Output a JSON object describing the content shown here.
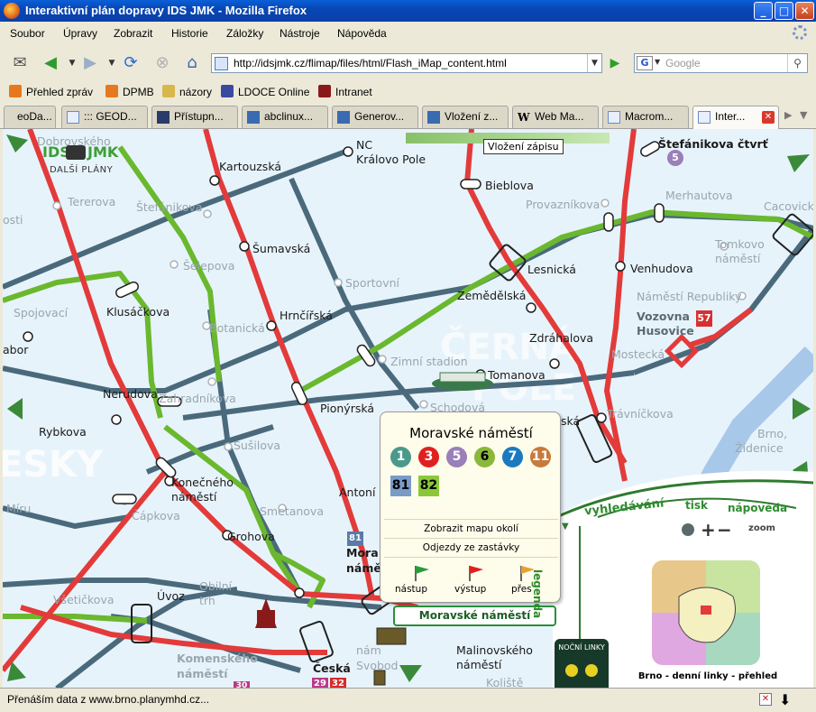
{
  "window": {
    "title": "Interaktivní plán dopravy IDS JMK - Mozilla Firefox",
    "minimize": "_",
    "maximize": "□",
    "close": "✕"
  },
  "menu": {
    "items": [
      "Soubor",
      "Úpravy",
      "Zobrazit",
      "Historie",
      "Záložky",
      "Nástroje",
      "Nápověda"
    ]
  },
  "navigation": {
    "url": "http://idsjmk.cz/flimap/files/html/Flash_iMap_content.html",
    "search_placeholder": "Google",
    "search_engine_letter": "G"
  },
  "bookmarks": [
    {
      "label": "Přehled zpráv",
      "icon": "rss-icon",
      "color": "#e8781e"
    },
    {
      "label": "DPMB",
      "icon": "rss-icon",
      "color": "#e8781e"
    },
    {
      "label": "názory",
      "icon": "folder-icon",
      "color": "#d8b84a"
    },
    {
      "label": "LDOCE Online",
      "icon": "ldoce-icon",
      "color": "#3a4aa0"
    },
    {
      "label": "Intranet",
      "icon": "intranet-icon",
      "color": "#8a1a1a"
    }
  ],
  "tabs": [
    {
      "label": "eoDa...",
      "active": false
    },
    {
      "label": "::: GEOD...",
      "active": false
    },
    {
      "label": "Přístupn...",
      "active": false
    },
    {
      "label": "abclinux...",
      "active": false
    },
    {
      "label": "Generov...",
      "active": false
    },
    {
      "label": "Vložení z...",
      "active": false
    },
    {
      "label": "Web Ma...",
      "active": false
    },
    {
      "label": "Macrom...",
      "active": false
    },
    {
      "label": "Inter...",
      "active": true
    }
  ],
  "map": {
    "tooltip": "Vložení zápisu",
    "logo": {
      "left": "IDS",
      "right": "JMK",
      "sub": "DALŠÍ PLÁNY"
    },
    "stations": [
      {
        "name": "Dobrovského",
        "faint": true
      },
      {
        "name": "Kartouzská",
        "faint": false
      },
      {
        "name": "NC",
        "faint": false
      },
      {
        "name": "Královo Pole",
        "faint": false
      },
      {
        "name": "Štefánikova čtvrť",
        "faint": false,
        "bold": true
      },
      {
        "name": "Bieblova",
        "faint": false
      },
      {
        "name": "Provazníkova",
        "faint": true
      },
      {
        "name": "Merhautova",
        "faint": true
      },
      {
        "name": "Cacovick",
        "faint": true
      },
      {
        "name": "Tererova",
        "faint": true
      },
      {
        "name": "Štefánikova",
        "faint": true
      },
      {
        "name": "osti",
        "faint": true
      },
      {
        "name": "Šumavská",
        "faint": false
      },
      {
        "name": "Šelepova",
        "faint": true
      },
      {
        "name": "Sportovní",
        "faint": true
      },
      {
        "name": "Lesnická",
        "faint": false
      },
      {
        "name": "Venhudova",
        "faint": false
      },
      {
        "name": "Tomkovo",
        "faint": true
      },
      {
        "name": "náměstí",
        "faint": true
      },
      {
        "name": "Spojovací",
        "faint": true
      },
      {
        "name": "Klusáčkova",
        "faint": false
      },
      {
        "name": "Hrnčířská",
        "faint": false
      },
      {
        "name": "Zemědělská",
        "faint": false
      },
      {
        "name": "Náměstí Republiky",
        "faint": true
      },
      {
        "name": "Botanická",
        "faint": true
      },
      {
        "name": "Zdráhalova",
        "faint": false
      },
      {
        "name": "Vozovna",
        "faint": false,
        "bold": true
      },
      {
        "name": "Husovice",
        "faint": false,
        "bold": true
      },
      {
        "name": "Mostecká",
        "faint": true
      },
      {
        "name": "abor",
        "faint": false
      },
      {
        "name": "Zimní stadion",
        "faint": true
      },
      {
        "name": "Tomanova",
        "faint": false
      },
      {
        "name": "Nerudova",
        "faint": false
      },
      {
        "name": "Zahradníkova",
        "faint": true
      },
      {
        "name": "Pionýrská",
        "faint": false
      },
      {
        "name": "Schodová",
        "faint": true
      },
      {
        "name": "ská",
        "faint": false
      },
      {
        "name": "Trávníčkova",
        "faint": true
      },
      {
        "name": "Rybkova",
        "faint": false
      },
      {
        "name": "Sušilova",
        "faint": true
      },
      {
        "name": "Brno,",
        "faint": true
      },
      {
        "name": "Židenice",
        "faint": true
      },
      {
        "name": "Konečného",
        "faint": false
      },
      {
        "name": "náměstí",
        "faint": false
      },
      {
        "name": "Antoní",
        "faint": false
      },
      {
        "name": "Míru",
        "faint": true
      },
      {
        "name": "Čápkova",
        "faint": true
      },
      {
        "name": "Smetanova",
        "faint": true
      },
      {
        "name": "Grohova",
        "faint": false
      },
      {
        "name": "Mora",
        "faint": false,
        "bold": true
      },
      {
        "name": "námě",
        "faint": false,
        "bold": true
      },
      {
        "name": "Všetičkova",
        "faint": true
      },
      {
        "name": "Úvoz",
        "faint": false
      },
      {
        "name": "Obilní",
        "faint": true
      },
      {
        "name": "trh",
        "faint": true
      },
      {
        "name": "Komenského",
        "faint": true,
        "bold": true
      },
      {
        "name": "náměstí",
        "faint": true,
        "bold": true
      },
      {
        "name": "Česká",
        "faint": false,
        "bold": true
      },
      {
        "name": "nám",
        "faint": true
      },
      {
        "name": "Svobod",
        "faint": true
      },
      {
        "name": "Malinovského",
        "faint": false
      },
      {
        "name": "náměstí",
        "faint": false
      },
      {
        "name": "Koliště",
        "faint": true
      }
    ],
    "districts": [
      "ČERNÁ",
      "POLE",
      "ESKY"
    ],
    "badges": [
      {
        "text": "5",
        "color": "#9a7fb8"
      },
      {
        "text": "57",
        "color": "#d83030"
      },
      {
        "text": "81",
        "color": "#5a7aa8"
      },
      {
        "text": "29",
        "color": "#b83a8a"
      },
      {
        "text": "32",
        "color": "#d82a2a"
      },
      {
        "text": "30",
        "color": "#b83a8a"
      }
    ]
  },
  "popup": {
    "title": "Moravské náměstí",
    "lines": [
      {
        "num": "1",
        "color": "#4a9a8a"
      },
      {
        "num": "3",
        "color": "#e02020"
      },
      {
        "num": "5",
        "color": "#9a7fb8"
      },
      {
        "num": "6",
        "color": "#8ab83a"
      },
      {
        "num": "7",
        "color": "#1a7ac0"
      },
      {
        "num": "11",
        "color": "#c87a3a"
      }
    ],
    "buses": [
      {
        "num": "81",
        "color": "#7a9ac8"
      },
      {
        "num": "82",
        "color": "#8ac83a"
      }
    ],
    "actions": [
      "Zobrazit mapu okolí",
      "Odjezdy ze zastávky"
    ],
    "flags": [
      {
        "label": "nástup",
        "color": "#2a9a3a"
      },
      {
        "label": "výstup",
        "color": "#e02020"
      },
      {
        "label": "přes",
        "color": "#e8a030"
      }
    ]
  },
  "station_box": "Moravské náměstí",
  "controls": {
    "search": "vyhledávání",
    "print": "tisk",
    "help": "nápověda",
    "zoom": "zoom",
    "legend": "legenda",
    "night_lines": "NOČNÍ LINKY",
    "minimap_caption": "Brno - denní linky - přehled"
  },
  "status": {
    "text": "Přenáším data z www.brno.planymhd.cz..."
  }
}
